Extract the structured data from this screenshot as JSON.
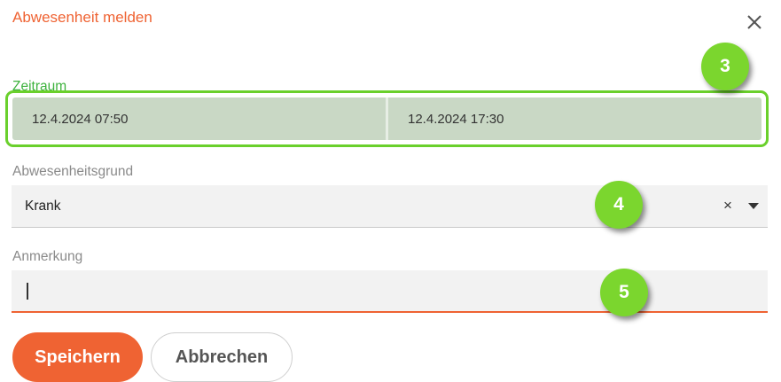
{
  "dialog": {
    "title": "Abwesenheit melden",
    "close_icon": "close-icon"
  },
  "period": {
    "label": "Zeitraum",
    "start": "12.4.2024 07:50",
    "end": "12.4.2024 17:30"
  },
  "reason": {
    "label": "Abwesenheitsgrund",
    "value": "Krank",
    "clear_symbol": "×",
    "arrow_icon": "caret-down-icon"
  },
  "note": {
    "label": "Anmerkung",
    "value": ""
  },
  "buttons": {
    "save": "Speichern",
    "cancel": "Abbrechen"
  },
  "annotations": {
    "step3": "3",
    "step4": "4",
    "step5": "5"
  },
  "colors": {
    "accent": "#ef6333",
    "highlight": "#6ad02c",
    "badge": "#7bd62e",
    "field_bg": "#f2f2f2"
  }
}
